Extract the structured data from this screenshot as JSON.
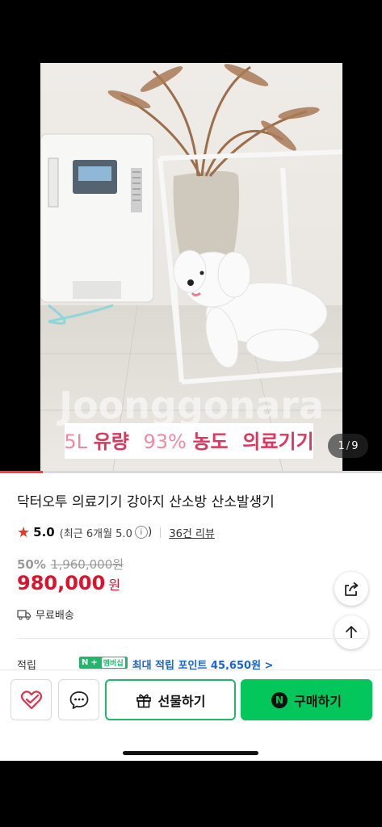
{
  "media": {
    "watermark": "Joonggonara",
    "caption_prefix": "5L",
    "caption_flow": "유량",
    "caption_percent": "93%",
    "caption_conc": "농도",
    "caption_rest": "의료기기",
    "current_page": "1",
    "separator": "/",
    "total_pages": "9",
    "progress_fraction": 0.111
  },
  "product": {
    "title": "닥터오투 의료기기 강아지 산소방 산소발생기",
    "rating": "5.0",
    "recent_rating": "(최근 6개월 5.0",
    "info_glyph": "i",
    "recent_close": ")",
    "review_count": "36건 리뷰",
    "discount_rate": "50%",
    "original_price": "1,960,000원",
    "sale_price": "980,000",
    "price_unit": "원",
    "shipping": "무료배송",
    "points_label": "적립",
    "npay_n": "N",
    "npay_plus": "+",
    "membership": "멤버십",
    "points_text": "최대 적립 포인트 45,650원 >"
  },
  "actions": {
    "gift_label": "선물하기",
    "buy_label": "구매하기",
    "npay_symbol": "N"
  },
  "colors": {
    "accent_red": "#e0112b",
    "naver_green": "#03c75a",
    "link_blue": "#1a63d6"
  },
  "icons": [
    "heart-check-icon",
    "chat-icon",
    "gift-icon",
    "share-icon",
    "arrow-up-icon",
    "truck-icon",
    "star-icon"
  ]
}
